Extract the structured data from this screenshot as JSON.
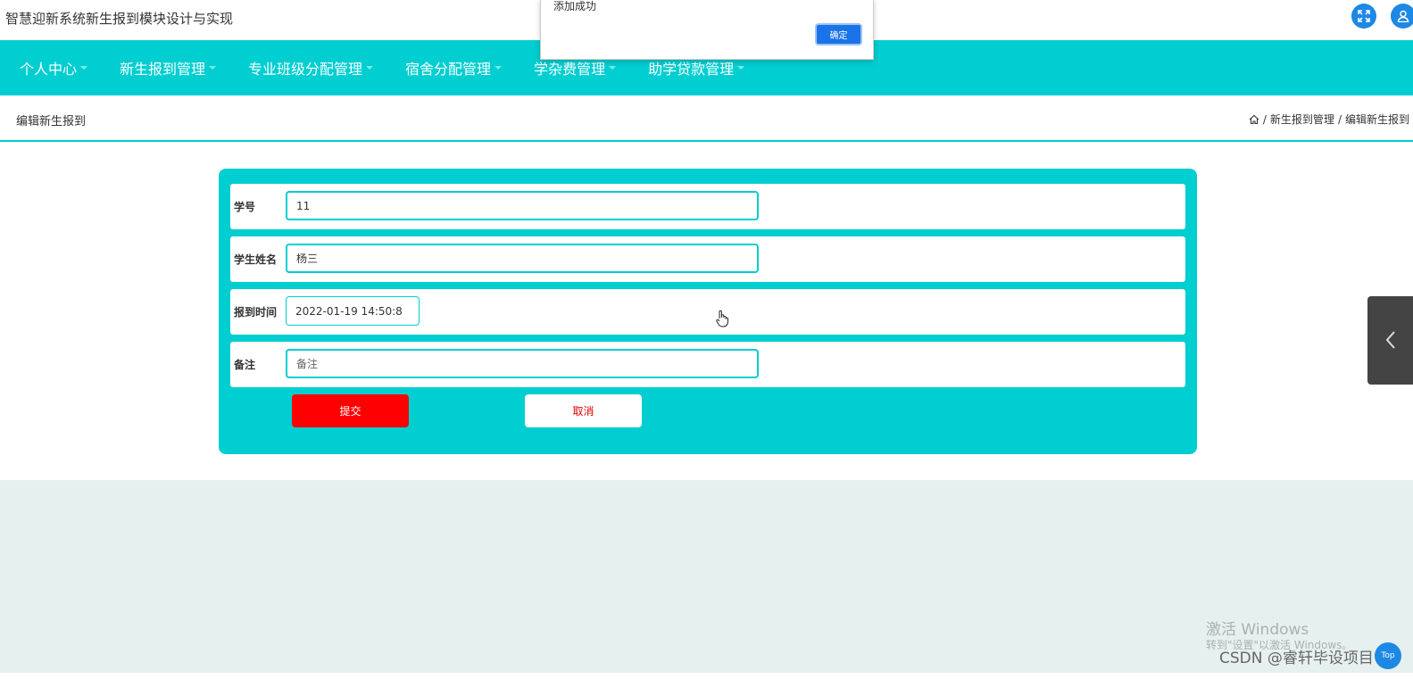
{
  "app": {
    "title": "智慧迎新系统新生报到模块设计与实现"
  },
  "nav": {
    "items": [
      {
        "label": "个人中心"
      },
      {
        "label": "新生报到管理"
      },
      {
        "label": "专业班级分配管理"
      },
      {
        "label": "宿舍分配管理"
      },
      {
        "label": "学杂费管理"
      },
      {
        "label": "助学贷款管理"
      }
    ]
  },
  "subheader": {
    "page_title": "编辑新生报到",
    "breadcrumb": [
      "/",
      "新生报到管理",
      "/",
      "编辑新生报到"
    ]
  },
  "form": {
    "student_id": {
      "label": "学号",
      "value": "11"
    },
    "student_name": {
      "label": "学生姓名",
      "value": "杨三"
    },
    "report_time": {
      "label": "报到时间",
      "value": "2022-01-19 14:50:8"
    },
    "remark": {
      "label": "备注",
      "value": "",
      "placeholder": "备注"
    },
    "submit_label": "提交",
    "cancel_label": "取消"
  },
  "alert": {
    "message": "添加成功",
    "ok_label": "确定"
  },
  "watermark": {
    "line1": "激活 Windows",
    "line2": "转到\"设置\"以激活 Windows。",
    "csdn": "CSDN @睿轩毕设项目",
    "top_button": "Top"
  },
  "colors": {
    "accent": "#00ced1",
    "submit": "#ff0000",
    "icon_blue": "#1e88e5"
  },
  "icons": [
    "fullscreen-icon",
    "user-icon",
    "home-icon",
    "chevron-left-icon",
    "hand-cursor-icon"
  ]
}
